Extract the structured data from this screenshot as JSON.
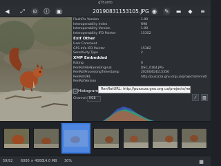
{
  "window": {
    "title": "gThumb"
  },
  "toolbar": {
    "filename": "20190831153105.JPG",
    "icons": [
      "back-arrow-icon",
      "fullscreen-icon",
      "zoom-fit-icon",
      "image-info-icon",
      "edit-image-icon",
      "color-picker-icon",
      "pencil-icon",
      "browse-icon",
      "tag-icon",
      "menu-icon"
    ]
  },
  "metadata": {
    "rows_top": [
      {
        "k": "FlashPix Version",
        "v": "1.00"
      },
      {
        "k": "Interoperability Index",
        "v": "R98"
      },
      {
        "k": "Interoperability Version",
        "v": "1.00"
      },
      {
        "k": "Interoperability IFD Pointer",
        "v": "15352"
      }
    ],
    "section_exif_other": "Exif Other",
    "rows_exif_other": [
      {
        "k": "User Comment",
        "v": ""
      },
      {
        "k": "GPS Info IFD Pointer",
        "v": "15382"
      },
      {
        "k": "Sensitivity Type",
        "v": "2"
      }
    ],
    "section_xmp": "XMP Embedded",
    "rows_xmp": [
      {
        "k": "Rating",
        "v": "0"
      },
      {
        "k": "RenRotFileNameOriginal",
        "v": "DSC_0164.JPG"
      },
      {
        "k": "RenRotProcessingTimestamp",
        "v": "20200414115356"
      },
      {
        "k": "RenRotURL",
        "v": "http://puszcza.gnu.org.ua/projects/renrot/"
      },
      {
        "k": "RenRotVersion",
        "v": ""
      }
    ],
    "tooltip": "RenRotURL: http://puszcza.gnu.org.ua/projects/renrot/"
  },
  "histogram": {
    "title": "Histogram",
    "channel_label": "Channel:",
    "channel_value": "RGB"
  },
  "status": {
    "index": "59/92",
    "dimensions": "6000 × 4000",
    "size": "14.0 MB",
    "zoom": "30%"
  },
  "colors": {
    "selection": "#3c7ce0",
    "panel": "#2b2f34"
  }
}
